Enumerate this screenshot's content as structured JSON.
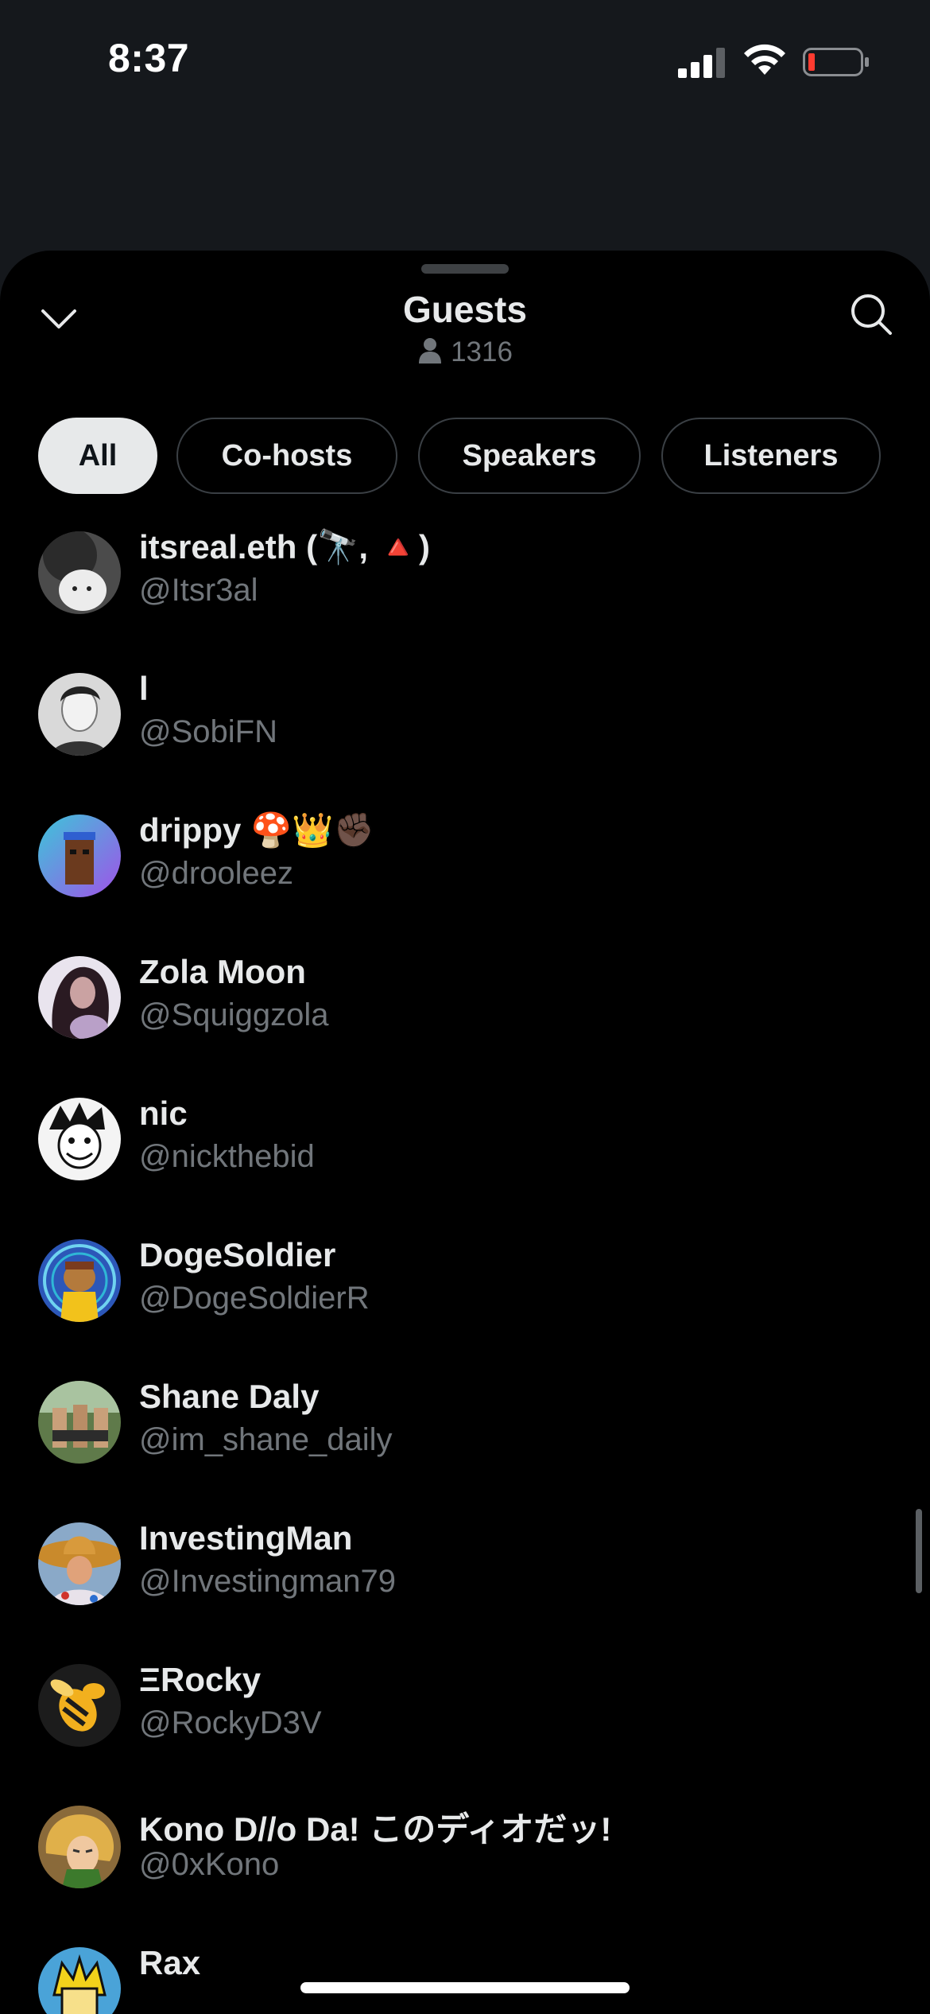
{
  "status": {
    "time": "8:37"
  },
  "sheet": {
    "title": "Guests",
    "count": "1316",
    "tabs": [
      {
        "label": "All",
        "active": true
      },
      {
        "label": "Co-hosts",
        "active": false
      },
      {
        "label": "Speakers",
        "active": false
      },
      {
        "label": "Listeners",
        "active": false
      }
    ]
  },
  "guests": [
    {
      "name": "itsreal.eth (🔭, 🔺)",
      "handle": "@Itsr3al",
      "avatar_color": "#6b6b6b"
    },
    {
      "name": "l",
      "handle": "@SobiFN",
      "avatar_color": "#cfcfcf"
    },
    {
      "name": "drippy 🍄👑✊🏿",
      "handle": "@drooleez",
      "avatar_color": "#7b5ce0"
    },
    {
      "name": "Zola Moon",
      "handle": "@Squiggzola",
      "avatar_color": "#b9a8d6"
    },
    {
      "name": "nic",
      "handle": "@nickthebid",
      "avatar_color": "#e0e0e0"
    },
    {
      "name": "DogeSoldier",
      "handle": "@DogeSoldierR",
      "avatar_color": "#3f7fd6"
    },
    {
      "name": "Shane Daly",
      "handle": "@im_shane_daily",
      "avatar_color": "#6f8a5a"
    },
    {
      "name": "InvestingMan",
      "handle": "@Investingman79",
      "avatar_color": "#c77a2c"
    },
    {
      "name": "ΞRocky",
      "handle": "@RockyD3V",
      "avatar_color": "#f2b01e"
    },
    {
      "name": "Kono D//o Da! このディオだッ!",
      "handle": "@0xKono",
      "avatar_color": "#d89a3c"
    },
    {
      "name": "Rax",
      "handle": "",
      "avatar_color": "#4aa3d8"
    }
  ],
  "icons": {
    "collapse": "chevron-down-icon",
    "search": "search-icon",
    "count": "person-icon"
  }
}
